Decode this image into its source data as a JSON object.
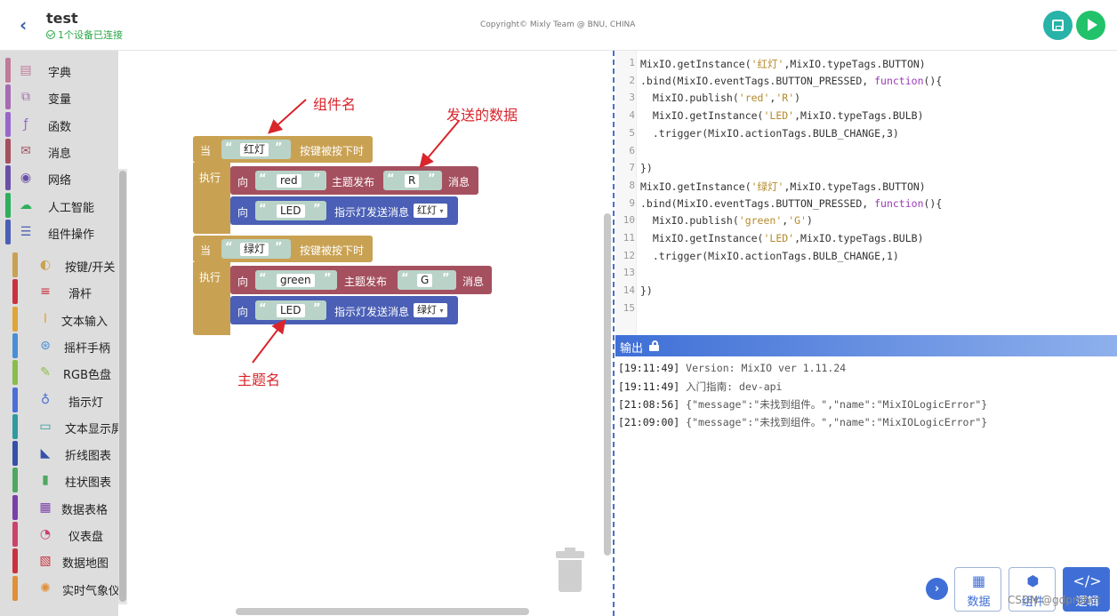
{
  "header": {
    "back": "‹",
    "title": "test",
    "device_status": "1个设备已连接",
    "copyright": "Copyright© Mixly Team @ BNU, CHINA"
  },
  "toolbox": {
    "categories": [
      {
        "label": "字典",
        "icon": "dictionary-icon",
        "color": "#c17b9a"
      },
      {
        "label": "变量",
        "icon": "variable-icon",
        "color": "#a66bb0"
      },
      {
        "label": "函数",
        "icon": "function-icon",
        "color": "#9966cc"
      },
      {
        "label": "消息",
        "icon": "mail-icon",
        "color": "#a5505f"
      },
      {
        "label": "网络",
        "icon": "globe-icon",
        "color": "#6a4fa8"
      },
      {
        "label": "人工智能",
        "icon": "cloud-icon",
        "color": "#2fae5c"
      },
      {
        "label": "组件操作",
        "icon": "list-icon",
        "color": "#4a5fb5"
      }
    ],
    "components": [
      {
        "label": "按键/开关",
        "icon": "toggle-icon",
        "color": "#c9a152"
      },
      {
        "label": "滑杆",
        "icon": "slider-icon",
        "color": "#c9333f"
      },
      {
        "label": "文本输入",
        "icon": "text-cursor-icon",
        "color": "#e0a53a"
      },
      {
        "label": "摇杆手柄",
        "icon": "gamepad-icon",
        "color": "#4a8fd6"
      },
      {
        "label": "RGB色盘",
        "icon": "brush-icon",
        "color": "#8bbd4a"
      },
      {
        "label": "指示灯",
        "icon": "bulb-icon",
        "color": "#4a6fd6"
      },
      {
        "label": "文本显示屏",
        "icon": "monitor-icon",
        "color": "#2f9aa0"
      },
      {
        "label": "折线图表",
        "icon": "area-chart-icon",
        "color": "#3551a8"
      },
      {
        "label": "柱状图表",
        "icon": "bar-chart-icon",
        "color": "#4fa860"
      },
      {
        "label": "数据表格",
        "icon": "table-icon",
        "color": "#7a3fa8"
      },
      {
        "label": "仪表盘",
        "icon": "gauge-icon",
        "color": "#c9436a"
      },
      {
        "label": "数据地图",
        "icon": "map-icon",
        "color": "#c9333f"
      },
      {
        "label": "实时气象仪",
        "icon": "sun-icon",
        "color": "#e0903a"
      }
    ]
  },
  "blocks": {
    "when": "当",
    "do": "执行",
    "to": "向",
    "quote_open": "“",
    "quote_close": "”",
    "button_pressed": "按键被按下时",
    "topic_publish": "主题发布",
    "message": "消息",
    "led_send": "指示灯发送消息",
    "group1": {
      "button": "红灯",
      "topic": "red",
      "data": "R",
      "led": "LED",
      "bulb": "红灯"
    },
    "group2": {
      "button": "绿灯",
      "topic": "green",
      "data": "G",
      "led": "LED",
      "bulb": "绿灯"
    }
  },
  "annotations": {
    "component_name": "组件名",
    "sent_data": "发送的数据",
    "topic_name": "主题名"
  },
  "code": {
    "lines": [
      {
        "n": "1",
        "t": "MixIO.getInstance('红灯',MixIO.typeTags.BUTTON)"
      },
      {
        "n": "2",
        "t": ".bind(MixIO.eventTags.BUTTON_PRESSED, function(){"
      },
      {
        "n": "3",
        "t": "  MixIO.publish('red','R')"
      },
      {
        "n": "4",
        "t": "  MixIO.getInstance('LED',MixIO.typeTags.BULB)"
      },
      {
        "n": "5",
        "t": "  .trigger(MixIO.actionTags.BULB_CHANGE,3)"
      },
      {
        "n": "6",
        "t": ""
      },
      {
        "n": "7",
        "t": "})"
      },
      {
        "n": "8",
        "t": "MixIO.getInstance('绿灯',MixIO.typeTags.BUTTON)"
      },
      {
        "n": "9",
        "t": ".bind(MixIO.eventTags.BUTTON_PRESSED, function(){"
      },
      {
        "n": "10",
        "t": "  MixIO.publish('green','G')"
      },
      {
        "n": "11",
        "t": "  MixIO.getInstance('LED',MixIO.typeTags.BULB)"
      },
      {
        "n": "12",
        "t": "  .trigger(MixIO.actionTags.BULB_CHANGE,1)"
      },
      {
        "n": "13",
        "t": ""
      },
      {
        "n": "14",
        "t": "})"
      },
      {
        "n": "15",
        "t": ""
      }
    ]
  },
  "output": {
    "title": "输出",
    "logs": [
      {
        "time": "[19:11:49]",
        "msg": "Version: MixIO ver 1.11.24"
      },
      {
        "time": "[19:11:49]",
        "msg": "入门指南: dev-api"
      },
      {
        "time": "[21:08:56]",
        "msg": "{\"message\":\"未找到组件。\",\"name\":\"MixIOLogicError\"}"
      },
      {
        "time": "[21:09:00]",
        "msg": "{\"message\":\"未找到组件。\",\"name\":\"MixIOLogicError\"}"
      }
    ]
  },
  "bottom_tabs": [
    {
      "label": "数据",
      "icon": "grid-icon"
    },
    {
      "label": "组件",
      "icon": "cube-icon"
    },
    {
      "label": "逻辑",
      "icon": "code-icon"
    }
  ],
  "expand": "›",
  "watermark": "CSDN @gdprobot"
}
